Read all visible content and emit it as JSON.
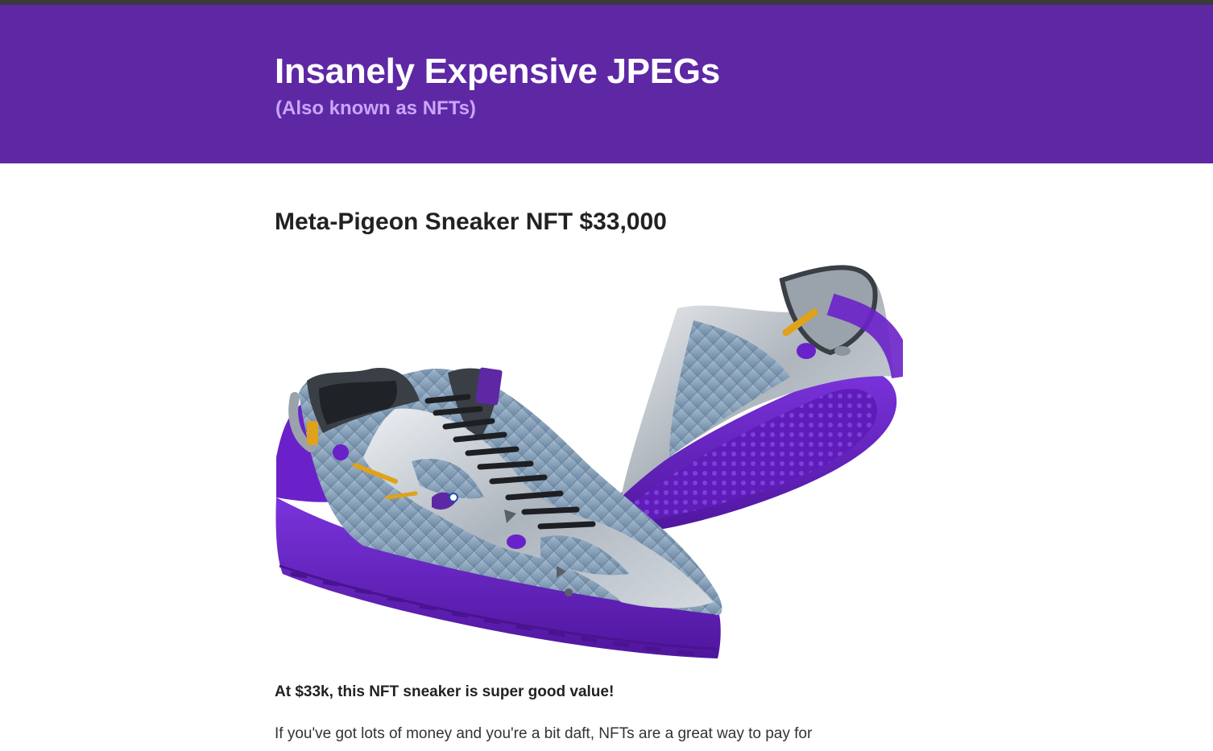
{
  "header": {
    "title": "Insanely Expensive JPEGs",
    "subtitle": "(Also known as NFTs)"
  },
  "article": {
    "title": "Meta-Pigeon Sneaker NFT $33,000",
    "image_subject": "sneaker-nft-image",
    "lead": "At $33k, this NFT sneaker is super good value!",
    "body": "If you've got lots of money and you're a bit daft, NFTs are a great way to pay for"
  },
  "colors": {
    "header_bg": "#5e28a5",
    "title_text": "#ffffff",
    "subtitle_text": "#c9a6f7",
    "sole_purple": "#6a21c9",
    "shoe_silver": "#c5ccd3",
    "shoe_blue": "#8fa6bd",
    "accent_yellow": "#e0a21b"
  }
}
